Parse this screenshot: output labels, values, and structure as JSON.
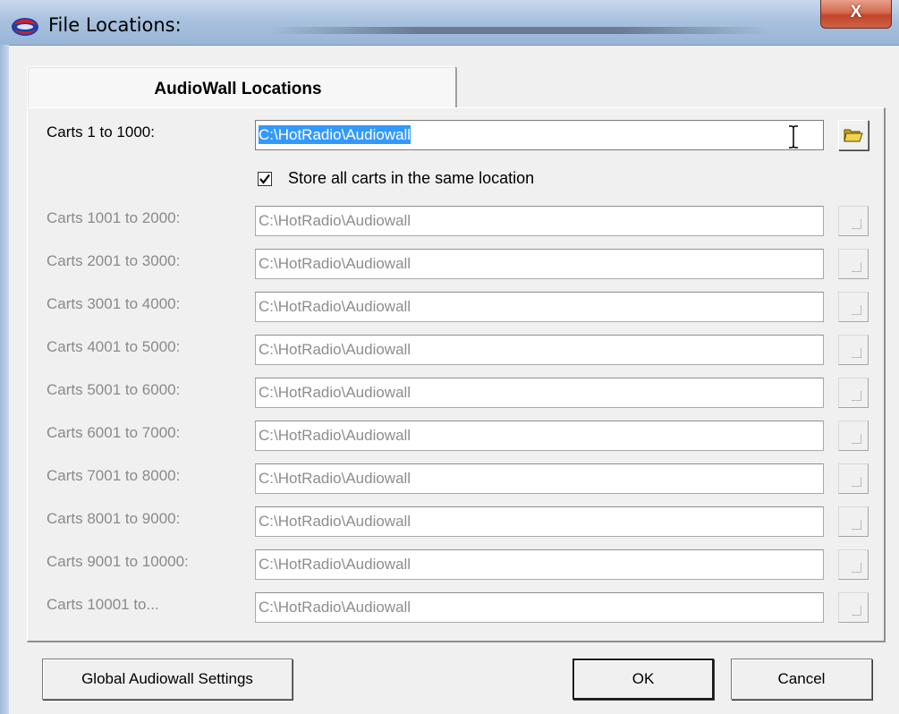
{
  "window": {
    "title": "File Locations:",
    "close_glyph": "X",
    "icon": "app-logo-icon"
  },
  "tab": {
    "label": "AudioWall Locations"
  },
  "primary": {
    "label": "Carts 1 to 1000:",
    "value": "C:\\HotRadio\\Audiowall",
    "browse_icon": "folder-open-icon"
  },
  "same_location": {
    "checked": true,
    "label": "Store all carts in the same location"
  },
  "rows": [
    {
      "label": "Carts 1001 to 2000:",
      "value": "C:\\HotRadio\\Audiowall"
    },
    {
      "label": "Carts 2001 to 3000:",
      "value": "C:\\HotRadio\\Audiowall"
    },
    {
      "label": "Carts 3001 to 4000:",
      "value": "C:\\HotRadio\\Audiowall"
    },
    {
      "label": "Carts 4001 to 5000:",
      "value": "C:\\HotRadio\\Audiowall"
    },
    {
      "label": "Carts 5001 to 6000:",
      "value": "C:\\HotRadio\\Audiowall"
    },
    {
      "label": "Carts 6001 to 7000:",
      "value": "C:\\HotRadio\\Audiowall"
    },
    {
      "label": "Carts 7001 to 8000:",
      "value": "C:\\HotRadio\\Audiowall"
    },
    {
      "label": "Carts 8001 to 9000:",
      "value": "C:\\HotRadio\\Audiowall"
    },
    {
      "label": "Carts 9001 to 10000:",
      "value": "C:\\HotRadio\\Audiowall"
    },
    {
      "label": "Carts 10001 to...",
      "value": "C:\\HotRadio\\Audiowall"
    }
  ],
  "buttons": {
    "global_settings": "Global Audiowall Settings",
    "ok": "OK",
    "cancel": "Cancel"
  }
}
